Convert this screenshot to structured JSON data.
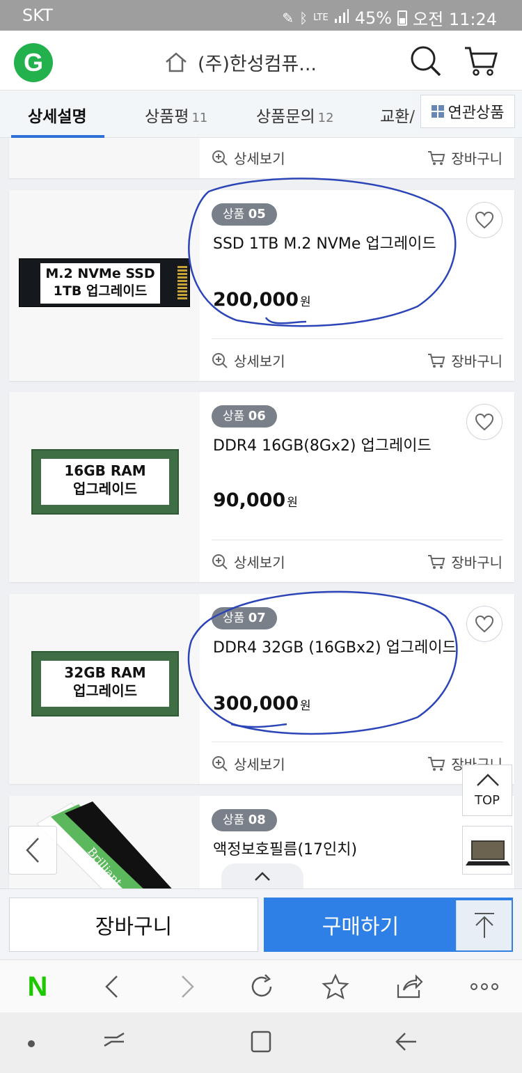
{
  "status_bar": {
    "carrier": "SKT",
    "network": "LTE",
    "battery": "45%",
    "time": "오전 11:24"
  },
  "header": {
    "logo": "G",
    "seller_name": "(주)한성컴퓨...",
    "icons": [
      "home-icon",
      "search-icon",
      "cart-icon"
    ]
  },
  "tabs": [
    {
      "label": "상세설명",
      "count": ""
    },
    {
      "label": "상품평",
      "count": "11"
    },
    {
      "label": "상품문의",
      "count": "12"
    },
    {
      "label": "교환/",
      "count": ""
    }
  ],
  "related_button": "연관상품",
  "card_actions": {
    "detail": "상세보기",
    "cart": "장바구니"
  },
  "products": [
    {
      "badge_prefix": "상품",
      "badge_num": "05",
      "name": "SSD 1TB M.2 NVMe 업그레이드",
      "price": "200,000",
      "unit": "원",
      "image_label": [
        "M.2 NVMe SSD",
        "1TB 업그레이드"
      ]
    },
    {
      "badge_prefix": "상품",
      "badge_num": "06",
      "name": "DDR4 16GB(8Gx2) 업그레이드",
      "price": "90,000",
      "unit": "원",
      "image_label": [
        "16GB RAM",
        "업그레이드"
      ]
    },
    {
      "badge_prefix": "상품",
      "badge_num": "07",
      "name": "DDR4 32GB (16GBx2) 업그레이드",
      "price": "300,000",
      "unit": "원",
      "image_label": [
        "32GB RAM",
        "업그레이드"
      ]
    },
    {
      "badge_prefix": "상품",
      "badge_num": "08",
      "name": "액정보호필름(17인치)",
      "image_label": [
        "Brilliant"
      ]
    }
  ],
  "floating": {
    "top_label": "TOP"
  },
  "buy_bar": {
    "cart_label": "장바구니",
    "buy_label": "구매하기"
  },
  "browser_bar": {
    "naver_logo": "N"
  },
  "colors": {
    "accent": "#2f80e6",
    "logo_green": "#22b14c",
    "annotation_blue": "#2b45b8",
    "naver_green": "#1ec800"
  }
}
